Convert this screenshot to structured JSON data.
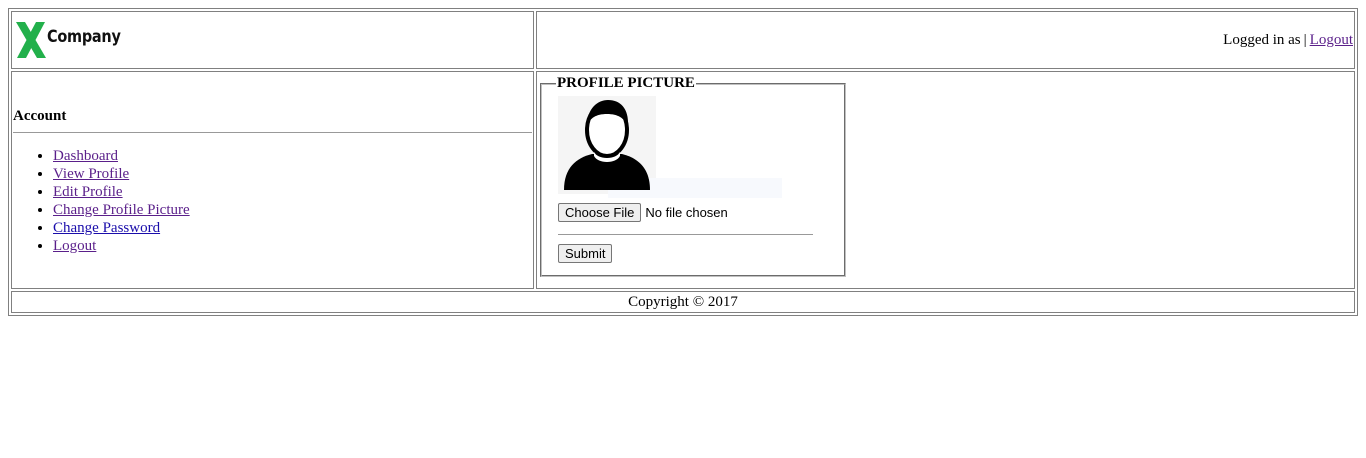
{
  "header": {
    "logo_text": "Company",
    "logged_in_label": "Logged in as",
    "separator": "|",
    "logout_link": "Logout",
    "logo_color": "#22b04b"
  },
  "sidebar": {
    "heading": "Account",
    "items": [
      {
        "label": "Dashboard"
      },
      {
        "label": "View Profile"
      },
      {
        "label": "Edit Profile"
      },
      {
        "label": "Change Profile Picture"
      },
      {
        "label": "Change Password"
      },
      {
        "label": "Logout"
      }
    ]
  },
  "profile_picture": {
    "legend": "PROFILE PICTURE",
    "avatar_icon": "user-silhouette-icon",
    "file_button": "Choose File",
    "file_status": "No file chosen",
    "submit_label": "Submit"
  },
  "footer": {
    "copyright": "Copyright © 2017"
  }
}
